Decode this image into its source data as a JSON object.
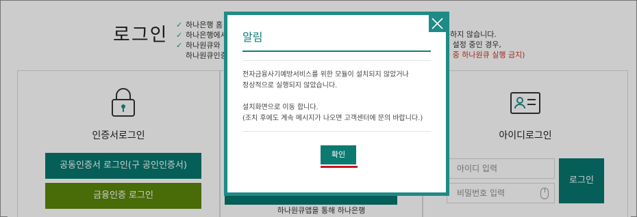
{
  "page": {
    "title": "로그인",
    "notice_lines": [
      "하나은행 홈",
      "하나은행에서",
      "하나원큐와 ",
      "하나원큐인증"
    ],
    "notice_right_1": "구하지 않습니다.",
    "notice_right_2": "인 설정 중인 경우,",
    "notice_right_3": "용 중 하나원큐 실행 금지)"
  },
  "cert_panel": {
    "label": "인증서로그인",
    "cert_button": "공동인증서 로그인(구 공인인증서)",
    "fin_button": "금융인증 로그인"
  },
  "mid_panel": {
    "note": "하나원큐앱을 통해 하나은행"
  },
  "id_panel": {
    "label": "아이디로그인",
    "id_placeholder": "아이디 입력",
    "pw_placeholder": "비밀번호 입력",
    "login_button": "로그인"
  },
  "modal": {
    "title": "알림",
    "message_1": "전자금융사기예방서비스를 위한 모듈이 설치되지 않았거나",
    "message_2": "정상적으로 실행되지 않았습니다.",
    "message_3": "설치화면으로 이동 합니다.",
    "message_4": "(조치 후에도 계속 메시지가 나오면 고객센터에 문의 바랍니다.)",
    "ok_button": "확인",
    "close_icon": "close-icon"
  },
  "colors": {
    "accent": "#07776f",
    "financial_green": "#5c860a",
    "modal_border": "#1e8b87",
    "highlight_red": "#d00f1c"
  }
}
